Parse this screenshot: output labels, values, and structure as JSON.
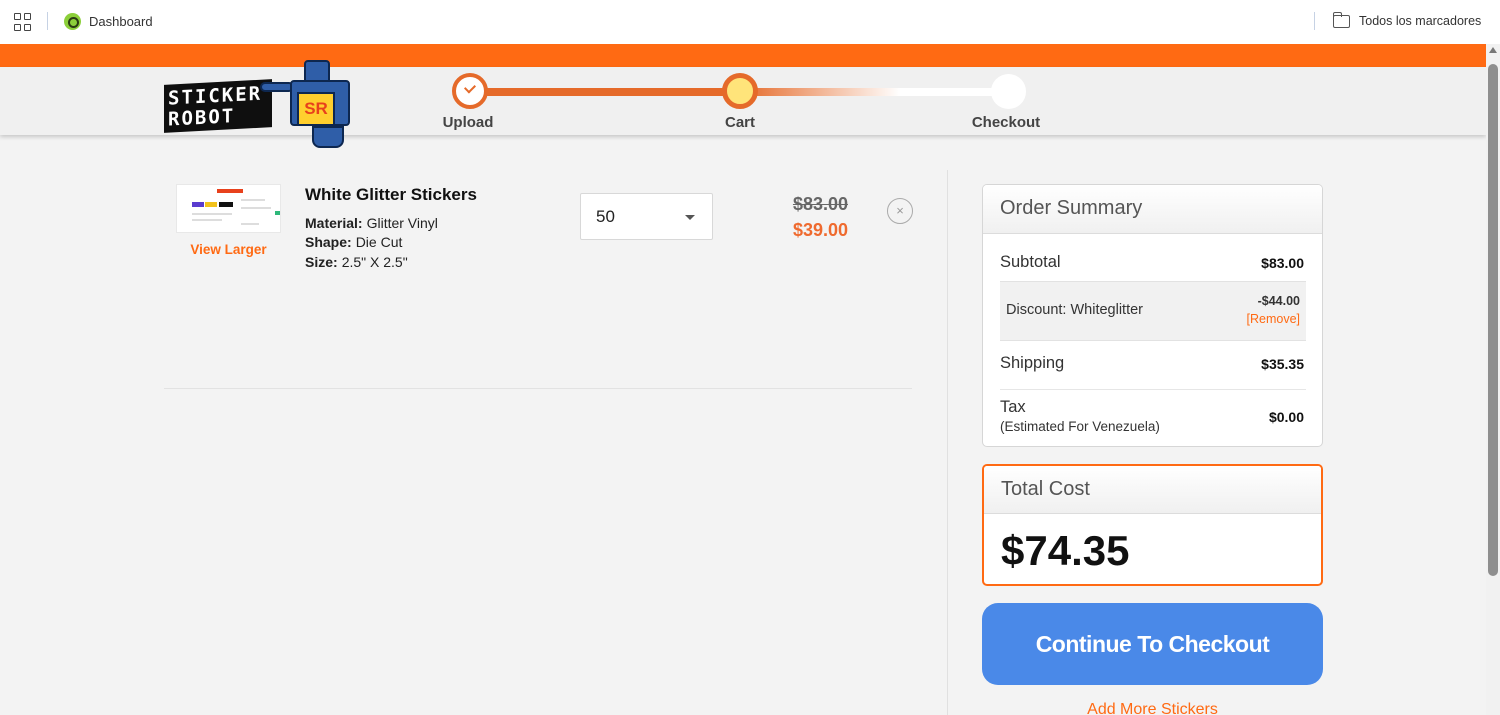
{
  "bookmarks_bar": {
    "dashboard_label": "Dashboard",
    "bookmarks_label": "Todos los marcadores"
  },
  "logo": {
    "text_line1": "STICKER",
    "text_line2": "ROBOT",
    "badge": "SR"
  },
  "progress": {
    "steps": [
      {
        "label": "Upload",
        "state": "done"
      },
      {
        "label": "Cart",
        "state": "current"
      },
      {
        "label": "Checkout",
        "state": "pending"
      }
    ],
    "accent_color": "#e56a2a"
  },
  "cart": {
    "item": {
      "title": "White Glitter Stickers",
      "view_larger": "View Larger",
      "attributes": [
        {
          "label": "Material:",
          "value": "Glitter Vinyl"
        },
        {
          "label": "Shape:",
          "value": "Die Cut"
        },
        {
          "label": "Size:",
          "value": "2.5\" X 2.5\""
        }
      ],
      "quantity": "50",
      "original_price": "$83.00",
      "discounted_price": "$39.00",
      "remove_symbol": "×"
    }
  },
  "summary": {
    "title": "Order Summary",
    "subtotal_label": "Subtotal",
    "subtotal_value": "$83.00",
    "discount_label": "Discount: Whiteglitter",
    "discount_value": "-$44.00",
    "discount_remove": "[Remove]",
    "shipping_label": "Shipping",
    "shipping_value": "$35.35",
    "tax_label": "Tax",
    "tax_note": "(Estimated For Venezuela)",
    "tax_value": "$0.00"
  },
  "total": {
    "title": "Total Cost",
    "value": "$74.35"
  },
  "actions": {
    "checkout": "Continue To Checkout",
    "add_more": "Add More Stickers"
  },
  "colors": {
    "brand_orange": "#ff6a13",
    "button_blue": "#4a89e8",
    "sale_price": "#ef6a2e"
  }
}
